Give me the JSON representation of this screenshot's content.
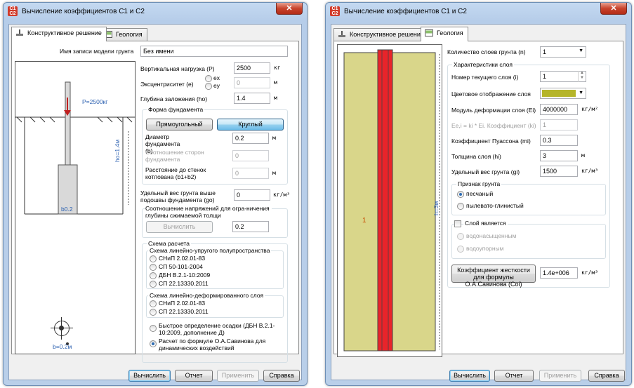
{
  "left_window": {
    "title": "Вычисление коэффициентов С1 и С2",
    "app_icon": "C1 C2",
    "close": "✕",
    "tabs": [
      "Конструктивное решение",
      "Геология"
    ],
    "model_name_label": "Имя записи модели грунта",
    "model_name_value": "Без имени",
    "vertical_load_label": "Вертикальная нагрузка (P)",
    "vertical_load_value": "2500",
    "vertical_load_unit": "кг",
    "eccentricity_label": "Эксцентриситет (e)",
    "ecc_ex": "ex",
    "ecc_ey": "ey",
    "eccentricity_value": "0",
    "eccentricity_unit": "м",
    "depth_label": "Глубина заложения (ho)",
    "depth_value": "1.4",
    "depth_unit": "м",
    "foundation_shape_group": "Форма фундамента",
    "shape_rect": "Прямоугольный",
    "shape_round": "Круглый",
    "diameter_label": "Диаметр фундамента (b)",
    "diameter_value": "0.2",
    "diameter_unit": "м",
    "sides_ratio_label": "Соотношение сторон фундамента",
    "sides_ratio_value": "0",
    "pit_distance_label": "Расстояние до стенок котлована (b1+b2)",
    "pit_distance_value": "0",
    "pit_distance_unit": "м",
    "unit_weight_label": "Удельный вес грунта выше подошвы фундамента (go)",
    "unit_weight_value": "0",
    "unit_weight_unit": "кг/м³",
    "stress_group": "Соотношение напряжений для огра-ничения глубины сжимаемой толщи",
    "calc_btn_small": "Вычислить",
    "stress_value": "0.2",
    "scheme_group": "Схема расчета",
    "scheme_half_space": "Схема линейно-упругого полупространства",
    "half_space_options": [
      "СНиП 2.02.01-83",
      "СП 50-101-2004",
      "ДБН В.2.1-10:2009",
      "СП 22.13330.2011"
    ],
    "scheme_layer": "Схема линейно-деформированного слоя",
    "layer_options": [
      "СНиП 2.02.01-83",
      "СП 22.13330.2011"
    ],
    "fast_settlement": "Быстрое определение осадки (ДБН В.2.1-10:2009, дополнение Д)",
    "savinov_calc": "Расчет по формуле О.А.Савинова для динамических воздействий",
    "diagram_load": "P=2500кг",
    "diagram_depth": "ho=1.4м",
    "diagram_width": "b0.2",
    "diagram_diameter": "b=0.2м",
    "footer": [
      "Вычислить",
      "Отчет",
      "Применить",
      "Справка"
    ]
  },
  "right_window": {
    "title": "Вычисление коэффициентов С1 и С2",
    "app_icon": "C1 C2",
    "close": "✕",
    "tabs": [
      "Конструктивное решение",
      "Геология"
    ],
    "layers_count_label": "Количество слоев грунта (n)",
    "layers_count_value": "1",
    "layer_props_group": "Характеристики слоя",
    "current_layer_label": "Номер текущего слоя (i)",
    "current_layer_value": "1",
    "color_label": "Цветовое отображение слоя",
    "layer_color": "#b5b52a",
    "modulus_label": "Модуль деформации слоя (Ei)",
    "modulus_value": "4000000",
    "modulus_unit": "кг/м²",
    "coef_label": "Ee,i = ki * Ei. Коэффициент (ki)",
    "coef_value": "1",
    "poisson_label": "Коэффициент Пуассона (mi)",
    "poisson_value": "0.3",
    "thickness_label": "Толщина слоя (hi)",
    "thickness_value": "3",
    "thickness_unit": "м",
    "unit_weight_label": "Удельный вес грунта (gi)",
    "unit_weight_value": "1500",
    "unit_weight_unit": "кг/м³",
    "soil_type_group": "Признак грунта",
    "soil_sand": "песчаный",
    "soil_clay": "пылевато-глинистый",
    "layer_is_group": "Слой является",
    "water_saturated": "водонасыщенным",
    "aquiclude": "водоупорным",
    "savinov_btn": "Коэффициент жесткости для формулы О.А.Савинова (Coi)",
    "savinov_value": "1.4e+006",
    "savinov_unit": "кг/м³",
    "diagram_layer_num": "1",
    "diagram_thickness": "h=3м",
    "footer": [
      "Вычислить",
      "Отчет",
      "Применить",
      "Справка"
    ]
  }
}
